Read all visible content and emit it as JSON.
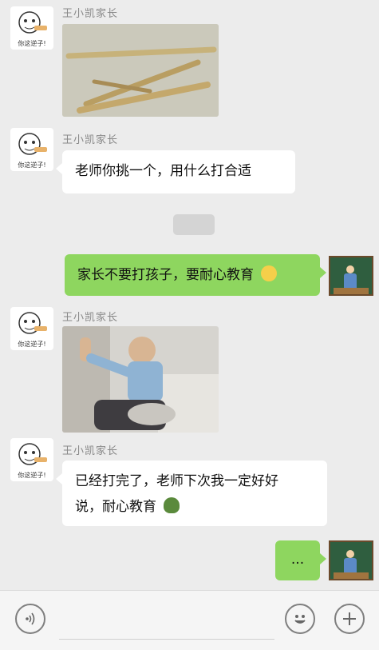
{
  "contact": {
    "name": "王小凯家长",
    "avatar_caption": "你这逆子!"
  },
  "messages": [
    {
      "id": 1,
      "side": "left",
      "type": "image",
      "sender": "王小凯家长",
      "image_desc": "wooden sticks photo"
    },
    {
      "id": 2,
      "side": "left",
      "type": "text",
      "sender": "王小凯家长",
      "text": "老师你挑一个，用什么打合适"
    },
    {
      "id": 3,
      "side": "right",
      "type": "text",
      "text": "家长不要打孩子，要耐心教育"
    },
    {
      "id": 4,
      "side": "left",
      "type": "image",
      "sender": "王小凯家长",
      "image_desc": "man disciplining child photo"
    },
    {
      "id": 5,
      "side": "left",
      "type": "text",
      "sender": "王小凯家长",
      "text_line1": "已经打完了，老师下次我一定好好",
      "text_line2": "说，耐心教育"
    },
    {
      "id": 6,
      "side": "right",
      "type": "text",
      "text": "..."
    }
  ],
  "input_bar": {
    "voice_icon": "voice-icon",
    "emoji_icon": "emoji-icon",
    "plus_icon": "plus-icon"
  },
  "colors": {
    "background": "#ececec",
    "right_bubble": "#8ed65f",
    "left_bubble": "#ffffff"
  }
}
